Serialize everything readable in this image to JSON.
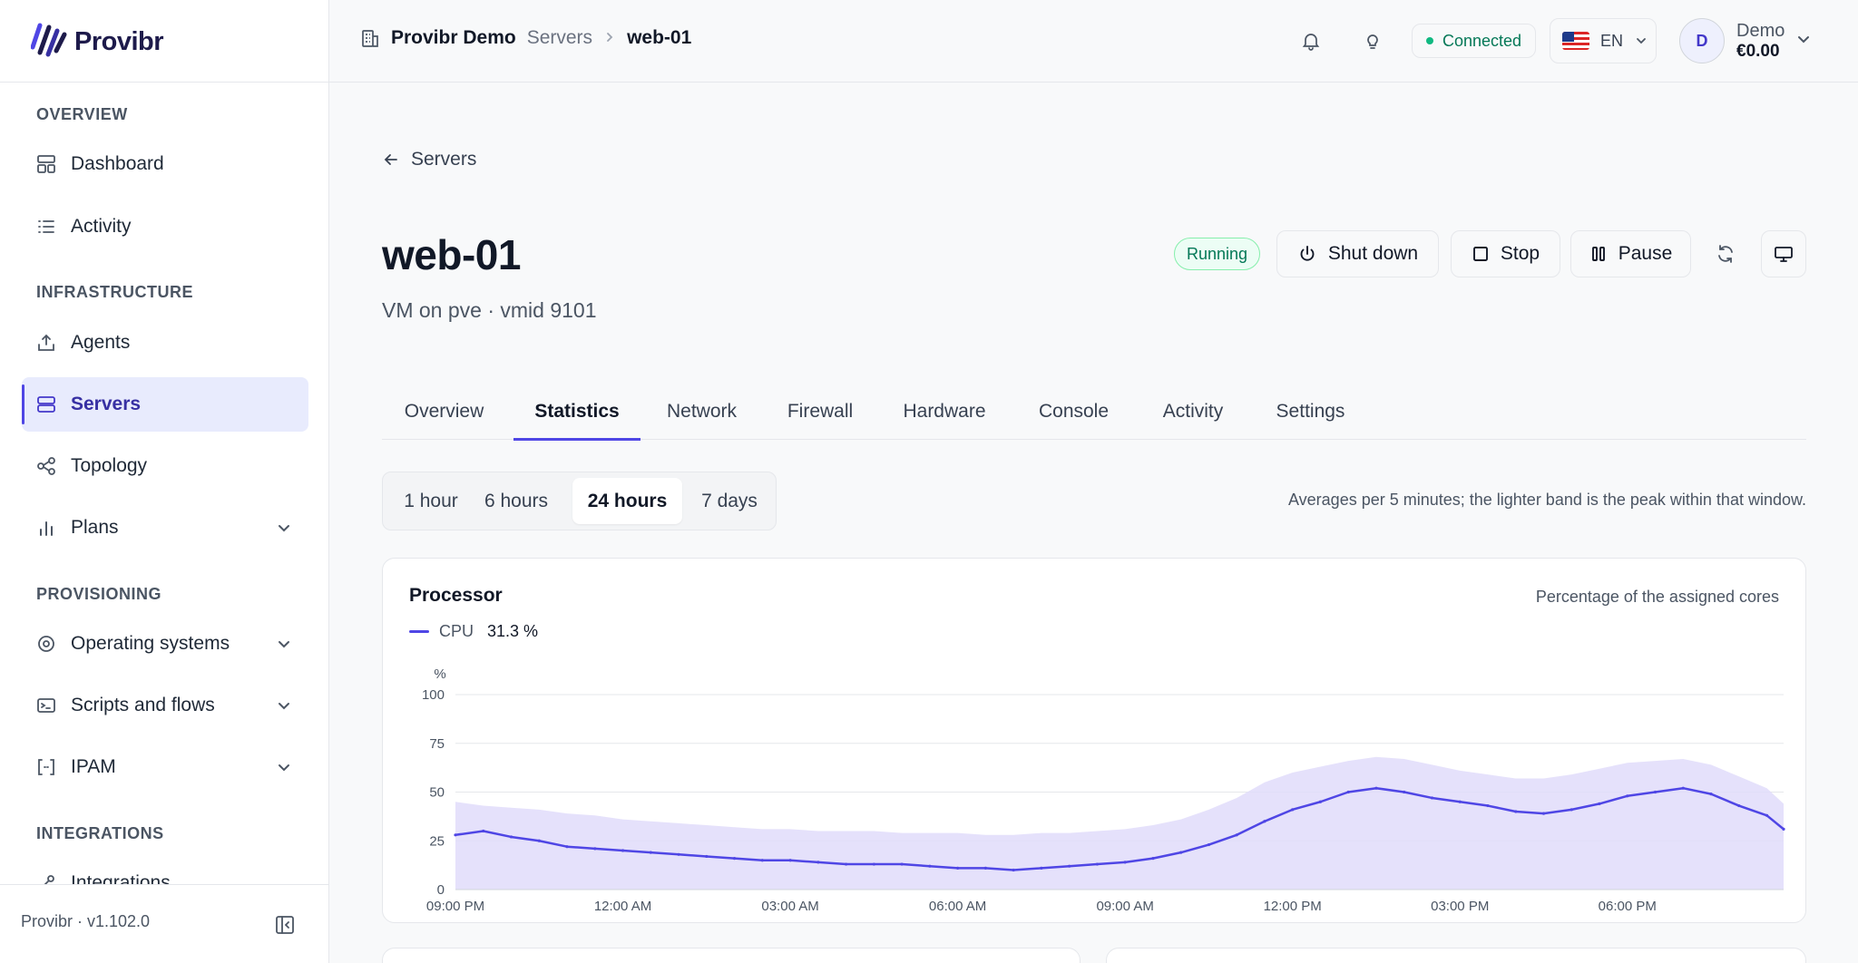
{
  "app": {
    "name": "Provibr",
    "version": "Provibr · v1.102.0"
  },
  "sidebar": {
    "sections": [
      {
        "label": "OVERVIEW"
      },
      {
        "label": "INFRASTRUCTURE"
      },
      {
        "label": "PROVISIONING"
      },
      {
        "label": "INTEGRATIONS"
      }
    ],
    "items": [
      {
        "label": "Dashboard",
        "icon": "dashboard-icon"
      },
      {
        "label": "Activity",
        "icon": "list-icon"
      },
      {
        "label": "Agents",
        "icon": "agents-icon"
      },
      {
        "label": "Servers",
        "icon": "servers-icon",
        "active": true
      },
      {
        "label": "Topology",
        "icon": "topology-icon"
      },
      {
        "label": "Plans",
        "icon": "bar-chart-icon",
        "expandable": true
      },
      {
        "label": "Operating systems",
        "icon": "disc-icon",
        "expandable": true
      },
      {
        "label": "Scripts and flows",
        "icon": "terminal-icon",
        "expandable": true
      },
      {
        "label": "IPAM",
        "icon": "ipam-icon",
        "expandable": true
      },
      {
        "label": "Integrations",
        "icon": "integrations-icon"
      }
    ]
  },
  "header": {
    "org": "Provibr Demo",
    "breadcrumb": [
      "Servers",
      "web-01"
    ],
    "connection": "Connected",
    "language": "EN",
    "user": {
      "initial": "D",
      "name": "Demo",
      "balance": "€0.00"
    }
  },
  "page": {
    "back_label": "Servers",
    "title": "web-01",
    "subtitle": "VM on pve · vmid 9101",
    "status": "Running",
    "actions": {
      "shutdown": "Shut down",
      "stop": "Stop",
      "pause": "Pause"
    },
    "tabs": [
      "Overview",
      "Statistics",
      "Network",
      "Firewall",
      "Hardware",
      "Console",
      "Activity",
      "Settings"
    ],
    "active_tab": "Statistics",
    "ranges": [
      "1 hour",
      "6 hours",
      "24 hours",
      "7 days"
    ],
    "active_range": "24 hours",
    "range_note": "Averages per 5 minutes; the lighter band is the peak within that window."
  },
  "processor_card": {
    "title": "Processor",
    "note": "Percentage of the assigned cores",
    "legend_label": "CPU",
    "legend_value": "31.3 %"
  },
  "colors": {
    "accent": "#4f46e5",
    "band": "#e0dcfa",
    "success": "#047857"
  },
  "chart_data": {
    "type": "area",
    "title": "Processor",
    "ylabel": "%",
    "ylim": [
      0,
      100
    ],
    "yticks": [
      0,
      25,
      50,
      75,
      100
    ],
    "xlim_hours": [
      21,
      44.8
    ],
    "xticks": [
      {
        "t": 21,
        "label": "09:00 PM"
      },
      {
        "t": 24,
        "label": "12:00 AM"
      },
      {
        "t": 27,
        "label": "03:00 AM"
      },
      {
        "t": 30,
        "label": "06:00 AM"
      },
      {
        "t": 33,
        "label": "09:00 AM"
      },
      {
        "t": 36,
        "label": "12:00 PM"
      },
      {
        "t": 39,
        "label": "03:00 PM"
      },
      {
        "t": 42,
        "label": "06:00 PM"
      }
    ],
    "series": [
      {
        "name": "CPU",
        "t": [
          21,
          21.5,
          22,
          22.5,
          23,
          23.5,
          24,
          24.5,
          25,
          25.5,
          26,
          26.5,
          27,
          27.5,
          28,
          28.5,
          29,
          29.5,
          30,
          30.5,
          31,
          31.5,
          32,
          32.5,
          33,
          33.5,
          34,
          34.5,
          35,
          35.5,
          36,
          36.5,
          37,
          37.5,
          38,
          38.5,
          39,
          39.5,
          40,
          40.5,
          41,
          41.5,
          42,
          42.5,
          43,
          43.5,
          44,
          44.5,
          44.8
        ],
        "avg": [
          28,
          30,
          27,
          25,
          22,
          21,
          20,
          19,
          18,
          17,
          16,
          15,
          15,
          14,
          13,
          13,
          13,
          12,
          11,
          11,
          10,
          11,
          12,
          13,
          14,
          16,
          19,
          23,
          28,
          35,
          41,
          45,
          50,
          52,
          50,
          47,
          45,
          43,
          40,
          39,
          41,
          44,
          48,
          50,
          52,
          49,
          43,
          38,
          31
        ],
        "peak": [
          45,
          43,
          42,
          41,
          39,
          38,
          36,
          35,
          34,
          33,
          32,
          31,
          31,
          30,
          30,
          30,
          29,
          29,
          29,
          28,
          28,
          29,
          29,
          30,
          31,
          33,
          36,
          41,
          47,
          55,
          60,
          63,
          66,
          68,
          67,
          64,
          61,
          59,
          57,
          57,
          59,
          62,
          65,
          66,
          67,
          64,
          58,
          52,
          44
        ]
      }
    ]
  }
}
